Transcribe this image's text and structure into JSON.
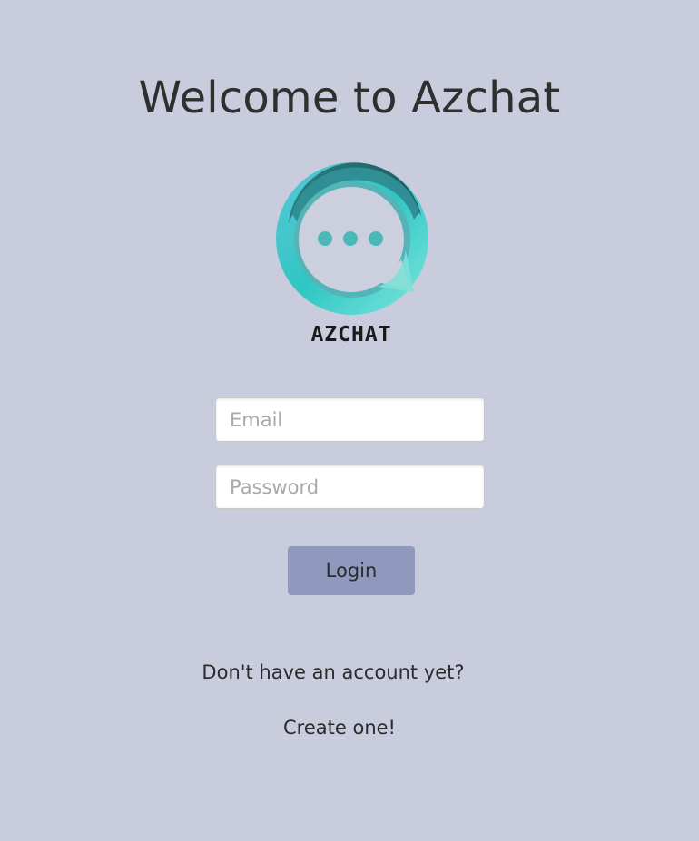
{
  "header": {
    "title": "Welcome to Azchat"
  },
  "logo": {
    "icon": "chat-bubble-logo",
    "text": "AZCHAT",
    "colors": {
      "ring_light": "#6fe0d8",
      "ring_mid": "#3fbfbe",
      "ring_dark": "#2a6f73",
      "dots": "#4bb8b8"
    }
  },
  "form": {
    "email": {
      "placeholder": "Email",
      "value": ""
    },
    "password": {
      "placeholder": "Password",
      "value": ""
    },
    "login_label": "Login"
  },
  "signup": {
    "prompt": "Don't have an account yet?",
    "link_label": "Create one!"
  },
  "colors": {
    "background": "#c9ccdd",
    "button": "#8f98bd"
  }
}
